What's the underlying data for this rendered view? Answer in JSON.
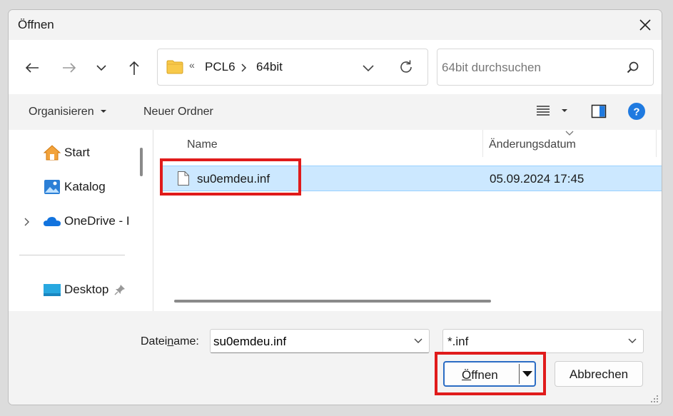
{
  "window": {
    "title": "Öffnen"
  },
  "navigation": {
    "path": [
      "PCL6",
      "64bit"
    ],
    "search_placeholder": "64bit durchsuchen"
  },
  "toolbar": {
    "organize": "Organisieren",
    "new_folder": "Neuer Ordner"
  },
  "sidebar": {
    "items": [
      {
        "label": "Start",
        "icon": "home-icon"
      },
      {
        "label": "Katalog",
        "icon": "gallery-icon"
      },
      {
        "label": "OneDrive - I",
        "icon": "onedrive-icon"
      },
      {
        "label": "Desktop",
        "icon": "desktop-icon",
        "pinned": true
      }
    ]
  },
  "columns": {
    "name": "Name",
    "date": "Änderungsdatum"
  },
  "files": [
    {
      "name": "su0emdeu.inf",
      "date": "05.09.2024 17:45",
      "selected": true
    }
  ],
  "footer": {
    "filename_label_pre": "Datei",
    "filename_label_underline": "n",
    "filename_label_post": "ame:",
    "filename_value": "su0emdeu.inf",
    "filetype_value": "*.inf",
    "open_underline": "Ö",
    "open_rest": "ffnen",
    "cancel_label": "Abbrechen"
  },
  "colors": {
    "accent": "#0067c0",
    "selection": "#cce8ff",
    "highlight": "#e01b1b"
  }
}
